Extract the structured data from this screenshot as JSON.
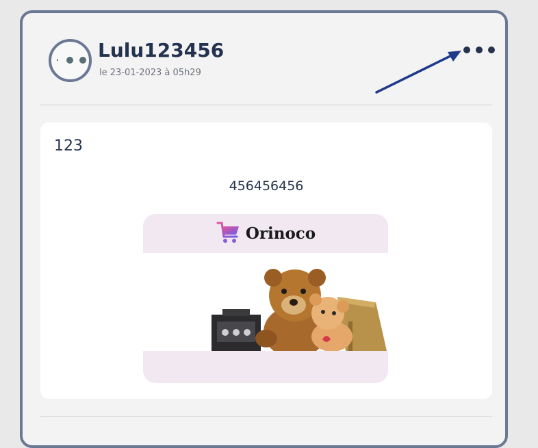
{
  "post": {
    "author": "Lulu123456",
    "date": "le 23-01-2023 à 05h29",
    "title": "123",
    "body": "456456456",
    "menu_icon": "more-horizontal-icon"
  },
  "image": {
    "logo_text": "Orinoco",
    "logo_icon": "shopping-cart-icon",
    "description_icon": "toy-products-photo"
  },
  "colors": {
    "card_border": "#6b7894",
    "text_dark": "#23324e",
    "arrow": "#1f3a8a",
    "image_bg": "#f1e8f1"
  }
}
